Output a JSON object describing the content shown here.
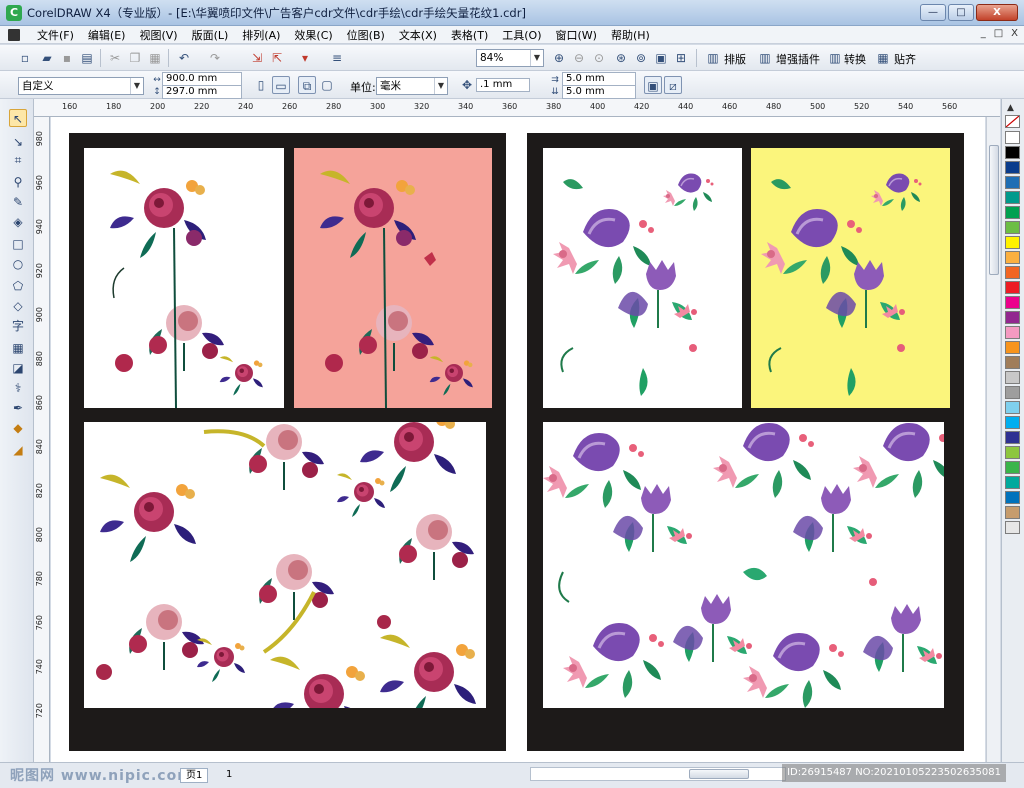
{
  "title_bar": {
    "app_icon": "coreldraw-icon",
    "title": "CorelDRAW X4（专业版）- [E:\\华翼喷印文件\\广告客户cdr文件\\cdr手绘\\cdr手绘矢量花纹1.cdr]",
    "minimize": "—",
    "maximize": "□",
    "close": "X"
  },
  "menu": {
    "items": [
      "文件(F)",
      "编辑(E)",
      "视图(V)",
      "版面(L)",
      "排列(A)",
      "效果(C)",
      "位图(B)",
      "文本(X)",
      "表格(T)",
      "工具(O)",
      "窗口(W)",
      "帮助(H)"
    ],
    "doc_controls": [
      "_",
      "□",
      "X"
    ]
  },
  "toolbar1": {
    "zoom_value": "84%",
    "buttons": [
      "排版",
      "增强插件",
      "转换",
      "贴齐"
    ]
  },
  "toolbar2": {
    "preset": "自定义",
    "width": "900.0 mm",
    "height": "297.0 mm",
    "unit_label": "单位:",
    "unit_value": "毫米",
    "nudge": ".1 mm",
    "dup_x": "5.0 mm",
    "dup_y": "5.0 mm"
  },
  "hruler": {
    "ticks": [
      "160",
      "180",
      "200",
      "220",
      "240",
      "260",
      "280",
      "300",
      "320",
      "340",
      "360",
      "380",
      "400",
      "420",
      "440",
      "460",
      "480",
      "500",
      "520",
      "540",
      "560"
    ]
  },
  "vruler": {
    "ticks": [
      "980",
      "960",
      "940",
      "920",
      "900",
      "880",
      "860",
      "840",
      "820",
      "800",
      "780",
      "760",
      "740",
      "720"
    ]
  },
  "toolbox": {
    "tools": [
      "pick-tool-icon",
      "shape-tool-icon",
      "crop-tool-icon",
      "zoom-tool-icon",
      "freehand-tool-icon",
      "smart-fill-icon",
      "rectangle-tool-icon",
      "ellipse-tool-icon",
      "polygon-tool-icon",
      "basic-shapes-icon",
      "text-tool-icon",
      "table-tool-icon",
      "interactive-blend-icon",
      "eyedropper-icon",
      "outline-pen-icon",
      "fill-tool-icon",
      "interactive-fill-icon"
    ],
    "text_tool_glyph": "字"
  },
  "palette": {
    "colors": [
      "#ffffff",
      "#000000",
      "#0a3c8c",
      "#1e6eb4",
      "#009a8c",
      "#00a050",
      "#6cbe45",
      "#fff200",
      "#fbb040",
      "#f26522",
      "#ed1c24",
      "#ec008c",
      "#92278f",
      "#f49ac1",
      "#f7941d",
      "#a07d5a",
      "#c8c8c8",
      "#9e9e9e",
      "#7fd0ee",
      "#00aeef",
      "#2e3192",
      "#8dc63f",
      "#39b54a",
      "#00a99d",
      "#0072bc",
      "#c69c6d",
      "#e6e6e6"
    ]
  },
  "status": {
    "page_tab": "页1",
    "page_counter": "1",
    "watermark_site": "昵图网 www.nipic.com",
    "id_text": "ID:26915487 NO:20210105223502635081"
  }
}
